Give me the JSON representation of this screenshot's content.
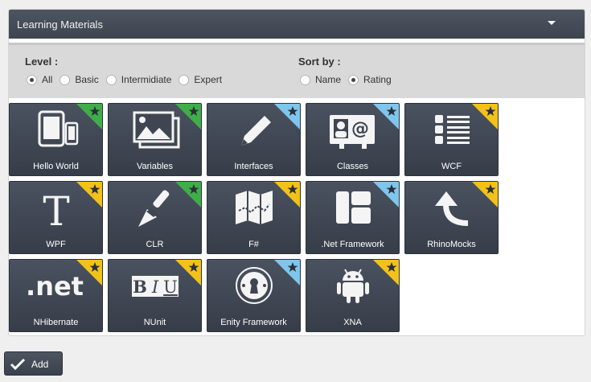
{
  "panel": {
    "title": "Learning Materials",
    "collapse_icon": "caret-down-icon"
  },
  "filters": {
    "level": {
      "label": "Level :",
      "options": [
        "All",
        "Basic",
        "Intermidiate",
        "Expert"
      ],
      "selected": "All"
    },
    "sort": {
      "label": "Sort by :",
      "options": [
        "Name",
        "Rating"
      ],
      "selected": "Rating"
    }
  },
  "badge_colors": {
    "green": "#3fae49",
    "blue": "#7fc6ec",
    "gold": "#f2c21a"
  },
  "tiles": [
    {
      "label": "Hello World",
      "icon": "tablet-phone-icon",
      "badge": "green"
    },
    {
      "label": "Variables",
      "icon": "images-icon",
      "badge": "green"
    },
    {
      "label": "Interfaces",
      "icon": "pencil-icon",
      "badge": "blue"
    },
    {
      "label": "Classes",
      "icon": "contact-card-icon",
      "badge": "blue"
    },
    {
      "label": "WCF",
      "icon": "list-icon",
      "badge": "gold"
    },
    {
      "label": "WPF",
      "icon": "text-icon",
      "badge": "gold"
    },
    {
      "label": "CLR",
      "icon": "brush-icon",
      "badge": "green"
    },
    {
      "label": "F#",
      "icon": "map-icon",
      "badge": "gold"
    },
    {
      "label": ".Net Framework",
      "icon": "layout-icon",
      "badge": "blue"
    },
    {
      "label": "RhinoMocks",
      "icon": "return-arrow-icon",
      "badge": "gold"
    },
    {
      "label": "NHibernate",
      "icon": "dotnet-icon",
      "badge": "gold"
    },
    {
      "label": "NUnit",
      "icon": "bold-italic-underline-icon",
      "badge": "gold"
    },
    {
      "label": "Enity Framework",
      "icon": "lock-icon",
      "badge": "blue"
    },
    {
      "label": "XNA",
      "icon": "android-icon",
      "badge": "gold"
    }
  ],
  "actions": {
    "add_label": "Add",
    "add_icon": "checkmark-icon"
  }
}
